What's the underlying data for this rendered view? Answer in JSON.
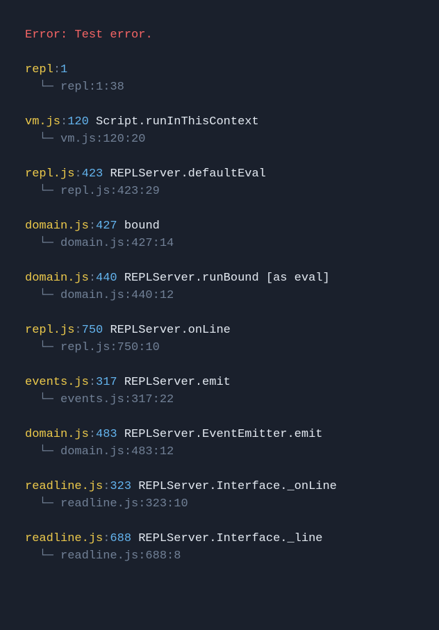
{
  "error": {
    "prefix": "Error:",
    "msg": "Test error."
  },
  "colon": ":",
  "space": " ",
  "tree": "  └─ ",
  "frames": [
    {
      "file": "repl",
      "line": "1",
      "method": "",
      "src": "repl:1:38"
    },
    {
      "file": "vm.js",
      "line": "120",
      "method": "Script.runInThisContext",
      "src": "vm.js:120:20"
    },
    {
      "file": "repl.js",
      "line": "423",
      "method": "REPLServer.defaultEval",
      "src": "repl.js:423:29"
    },
    {
      "file": "domain.js",
      "line": "427",
      "method": "bound",
      "src": "domain.js:427:14"
    },
    {
      "file": "domain.js",
      "line": "440",
      "method": "REPLServer.runBound [as eval]",
      "src": "domain.js:440:12"
    },
    {
      "file": "repl.js",
      "line": "750",
      "method": "REPLServer.onLine",
      "src": "repl.js:750:10"
    },
    {
      "file": "events.js",
      "line": "317",
      "method": "REPLServer.emit",
      "src": "events.js:317:22"
    },
    {
      "file": "domain.js",
      "line": "483",
      "method": "REPLServer.EventEmitter.emit",
      "src": "domain.js:483:12"
    },
    {
      "file": "readline.js",
      "line": "323",
      "method": "REPLServer.Interface._onLine",
      "src": "readline.js:323:10"
    },
    {
      "file": "readline.js",
      "line": "688",
      "method": "REPLServer.Interface._line",
      "src": "readline.js:688:8"
    }
  ]
}
